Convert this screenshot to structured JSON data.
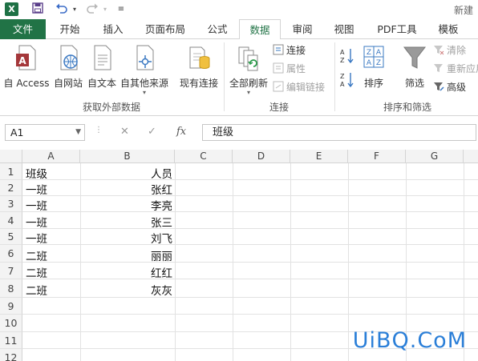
{
  "app": {
    "logo": "X",
    "document_title": "新建"
  },
  "quick_access": {
    "save_icon": "save-icon",
    "undo_icon": "undo-icon",
    "redo_icon": "redo-icon",
    "customize_icon": "customize-icon"
  },
  "tabs": [
    "文件",
    "开始",
    "插入",
    "页面布局",
    "公式",
    "数据",
    "审阅",
    "视图",
    "PDF工具",
    "模板"
  ],
  "active_tab": "数据",
  "ribbon": {
    "get_external": {
      "label": "获取外部数据",
      "buttons": [
        "自 Access",
        "自网站",
        "自文本",
        "自其他来源",
        "现有连接"
      ]
    },
    "connections": {
      "label": "连接",
      "refresh_all": "全部刷新",
      "connections_btn": "连接",
      "properties": "属性",
      "edit_links": "编辑链接"
    },
    "sort_filter": {
      "label": "排序和筛选",
      "sort": "排序",
      "filter": "筛选",
      "clear": "清除",
      "reapply": "重新应用",
      "advanced": "高级"
    }
  },
  "formula_bar": {
    "name_box": "A1",
    "fx": "fx",
    "content": "班级"
  },
  "columns": [
    "A",
    "B",
    "C",
    "D",
    "E",
    "F",
    "G"
  ],
  "rows": [
    "1",
    "2",
    "3",
    "4",
    "5",
    "6",
    "7",
    "8",
    "9",
    "10",
    "11",
    "12"
  ],
  "cells": {
    "A": [
      "班级",
      "一班",
      "一班",
      "一班",
      "一班",
      "二班",
      "二班",
      "二班"
    ],
    "B": [
      "人员",
      "张红",
      "李亮",
      "张三",
      "刘飞",
      "丽丽",
      "红红",
      "灰灰"
    ]
  },
  "watermark": "UiBQ.CoM",
  "colors": {
    "excel_green": "#217346",
    "header_bg": "#f3f3f3",
    "watermark": "#2b7fd8"
  }
}
